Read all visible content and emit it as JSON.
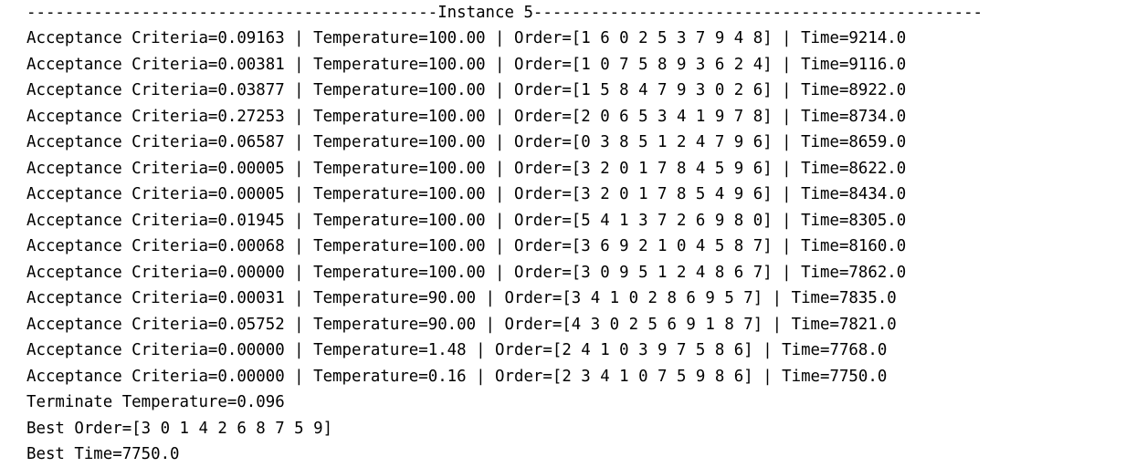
{
  "header": "-------------------------------------------Instance 5-----------------------------------------------",
  "log_lines": [
    "Acceptance Criteria=0.09163 | Temperature=100.00 | Order=[1 6 0 2 5 3 7 9 4 8] | Time=9214.0",
    "Acceptance Criteria=0.00381 | Temperature=100.00 | Order=[1 0 7 5 8 9 3 6 2 4] | Time=9116.0",
    "Acceptance Criteria=0.03877 | Temperature=100.00 | Order=[1 5 8 4 7 9 3 0 2 6] | Time=8922.0",
    "Acceptance Criteria=0.27253 | Temperature=100.00 | Order=[2 0 6 5 3 4 1 9 7 8] | Time=8734.0",
    "Acceptance Criteria=0.06587 | Temperature=100.00 | Order=[0 3 8 5 1 2 4 7 9 6] | Time=8659.0",
    "Acceptance Criteria=0.00005 | Temperature=100.00 | Order=[3 2 0 1 7 8 4 5 9 6] | Time=8622.0",
    "Acceptance Criteria=0.00005 | Temperature=100.00 | Order=[3 2 0 1 7 8 5 4 9 6] | Time=8434.0",
    "Acceptance Criteria=0.01945 | Temperature=100.00 | Order=[5 4 1 3 7 2 6 9 8 0] | Time=8305.0",
    "Acceptance Criteria=0.00068 | Temperature=100.00 | Order=[3 6 9 2 1 0 4 5 8 7] | Time=8160.0",
    "Acceptance Criteria=0.00000 | Temperature=100.00 | Order=[3 0 9 5 1 2 4 8 6 7] | Time=7862.0",
    "Acceptance Criteria=0.00031 | Temperature=90.00 | Order=[3 4 1 0 2 8 6 9 5 7] | Time=7835.0",
    "Acceptance Criteria=0.05752 | Temperature=90.00 | Order=[4 3 0 2 5 6 9 1 8 7] | Time=7821.0",
    "Acceptance Criteria=0.00000 | Temperature=1.48 | Order=[2 4 1 0 3 9 7 5 8 6] | Time=7768.0",
    "Acceptance Criteria=0.00000 | Temperature=0.16 | Order=[2 3 4 1 0 7 5 9 8 6] | Time=7750.0"
  ],
  "summary": {
    "terminate": "Terminate Temperature=0.096",
    "best_order": "Best Order=[3 0 1 4 2 6 8 7 5 9]",
    "best_time": "Best Time=7750.0"
  }
}
